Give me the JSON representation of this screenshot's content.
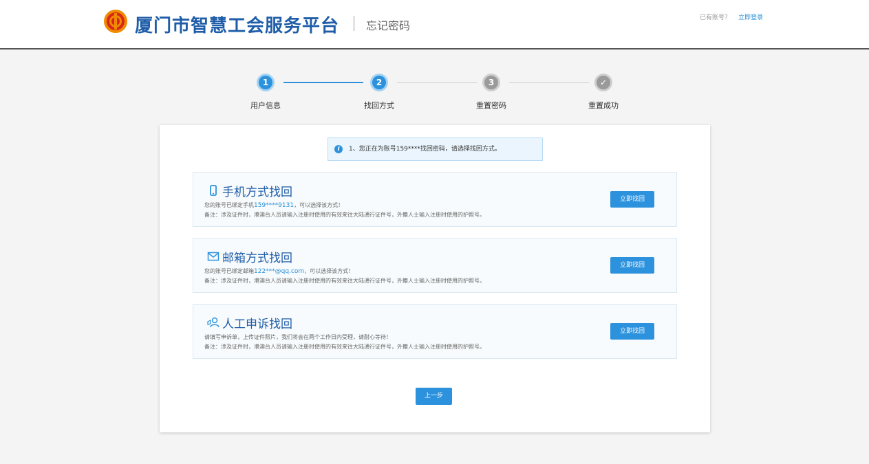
{
  "header": {
    "brand": "厦门市智慧工会服务平台",
    "subtitle": "忘记密码",
    "has_account": "已有账号？",
    "login_link": "立即登录"
  },
  "steps": [
    {
      "num": "1",
      "label": "用户信息",
      "state": "done"
    },
    {
      "num": "2",
      "label": "找回方式",
      "state": "active"
    },
    {
      "num": "3",
      "label": "重置密码",
      "state": "pending"
    },
    {
      "num": "✓",
      "label": "重置成功",
      "state": "pending"
    }
  ],
  "notice": {
    "icon": "i",
    "text": "1、您正在为账号159****找回密码，请选择找回方式。"
  },
  "options": [
    {
      "icon": "phone-icon",
      "title": "手机方式找回",
      "desc_prefix": "您的账号已绑定手机",
      "desc_highlight": "159****9131",
      "desc_suffix": "，可以选择该方式！",
      "note": "备注：涉及证件时，港澳台人员请输入注册时使用的有效来往大陆通行证件号，外籍人士输入注册时使用的护照号。",
      "button": "立即找回"
    },
    {
      "icon": "mail-icon",
      "title": "邮箱方式找回",
      "desc_prefix": "您的账号已绑定邮箱",
      "desc_highlight": "122***@qq.com",
      "desc_suffix": "，可以选择该方式！",
      "note": "备注：涉及证件时，港澳台人员请输入注册时使用的有效来往大陆通行证件号，外籍人士输入注册时使用的护照号。",
      "button": "立即找回"
    },
    {
      "icon": "person-appeal-icon",
      "title": "人工申诉找回",
      "desc_prefix": "请填写申诉单，上传证件照片，我们将会在两个工作日内受理，请耐心等待！",
      "desc_highlight": "",
      "desc_suffix": "",
      "note": "备注：涉及证件时，港澳台人员请输入注册时使用的有效来往大陆通行证件号，外籍人士输入注册时使用的护照号。",
      "button": "立即找回"
    }
  ],
  "prev_button": "上一步",
  "colors": {
    "primary": "#2d92dd",
    "brand": "#1f5da8",
    "logo_orange": "#f08a00",
    "logo_red": "#d7261e"
  }
}
